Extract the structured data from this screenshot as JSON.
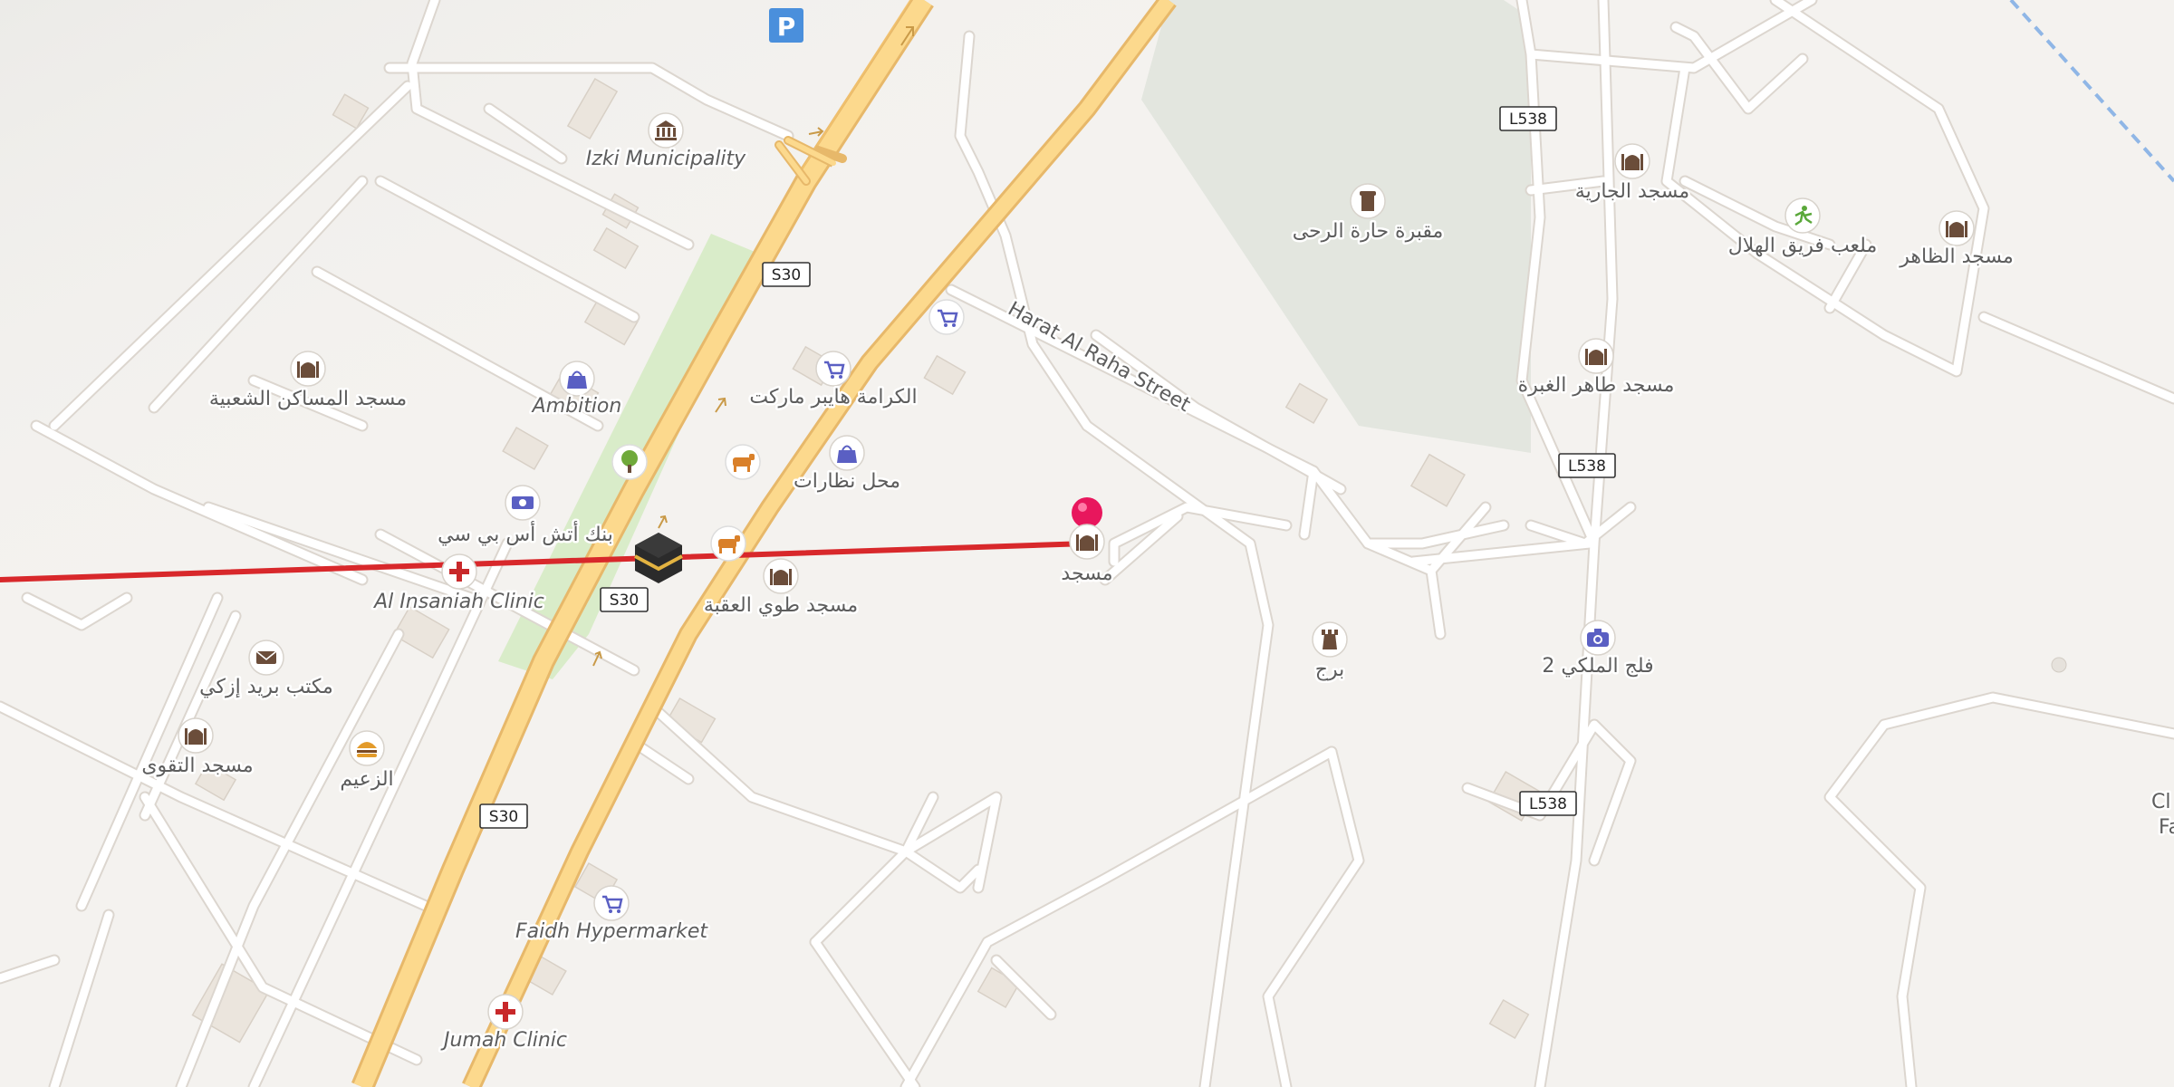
{
  "map": {
    "street_label": "Harat Al Raha Street",
    "road_shields": [
      "S30",
      "S30",
      "S30",
      "L538",
      "L538",
      "L538"
    ],
    "colors": {
      "background": "#f4f2ef",
      "minor_road": "#ffffff",
      "minor_road_casing": "#dcd6cf",
      "highway_fill": "#fcd98d",
      "highway_casing": "#e7b86a",
      "park": "#d9ecc9",
      "cemetery": "#e3e6df",
      "route_line": "#d8282b",
      "marker_pin": "#e8175d",
      "poi_blue": "#5a5fc3",
      "poi_brown": "#6b4d3a"
    },
    "pois": [
      {
        "name": "Izki Municipality",
        "icon": "townhall-icon"
      },
      {
        "name": "Ambition",
        "icon": "shopping-bag-icon"
      },
      {
        "name": "مسجد المساكن الشعبية",
        "icon": "mosque-icon"
      },
      {
        "name": "بنك أتش أس بي سي",
        "icon": "bank-note-icon"
      },
      {
        "name": "Al Insaniah Clinic",
        "icon": "clinic-cross-icon"
      },
      {
        "name": "مكتب بريد إزكي",
        "icon": "post-office-icon"
      },
      {
        "name": "مسجد التقوى",
        "icon": "mosque-icon"
      },
      {
        "name": "الزعيم",
        "icon": "fast-food-icon"
      },
      {
        "name": "Faidh Hypermarket",
        "icon": "shopping-cart-icon"
      },
      {
        "name": "Jumah Clinic",
        "icon": "clinic-cross-icon"
      },
      {
        "name": "الكرامة هايبر ماركت",
        "icon": "shopping-cart-icon"
      },
      {
        "name": "محل نظارات",
        "icon": "shopping-bag-icon"
      },
      {
        "name": "مسجد طوي العقبة",
        "icon": "mosque-icon"
      },
      {
        "name": "مسجد",
        "icon": "mosque-icon"
      },
      {
        "name": "مقبرة حارة الرحى",
        "icon": "cemetery-icon"
      },
      {
        "name": "مسجد الجارية",
        "icon": "mosque-icon"
      },
      {
        "name": "ملعب فريق الهلال",
        "icon": "sports-icon"
      },
      {
        "name": "مسجد الظاهر",
        "icon": "mosque-icon"
      },
      {
        "name": "مسجد طاهر الغبرة",
        "icon": "mosque-icon"
      },
      {
        "name": "برج",
        "icon": "tower-icon"
      },
      {
        "name": "فلج الملكي 2",
        "icon": "camera-icon"
      }
    ],
    "edge_text": [
      "Cl",
      "Fa"
    ]
  }
}
